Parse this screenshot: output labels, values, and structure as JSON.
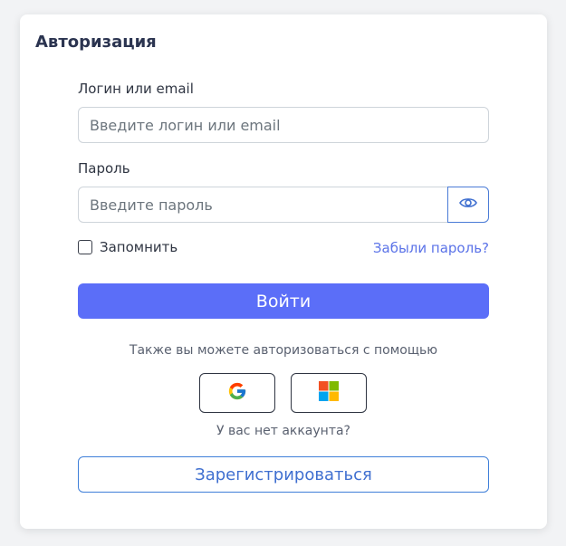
{
  "card": {
    "title": "Авторизация"
  },
  "login": {
    "label": "Логин или email",
    "placeholder": "Введите логин или email",
    "value": ""
  },
  "password": {
    "label": "Пароль",
    "placeholder": "Введите пароль",
    "value": "",
    "toggle_icon": "eye-icon"
  },
  "remember": {
    "label": "Запомнить",
    "checked": false
  },
  "forgot_link": "Забыли пароль?",
  "submit_label": "Войти",
  "social": {
    "prompt": "Также вы можете авторизоваться с помощью",
    "providers": [
      "google",
      "microsoft"
    ]
  },
  "register": {
    "prompt": "У вас нет аккаунта?",
    "button_label": "Зарегистрироваться"
  },
  "colors": {
    "accent": "#5b6ef8",
    "link": "#5b73e8",
    "outline": "#3f7fd9"
  }
}
